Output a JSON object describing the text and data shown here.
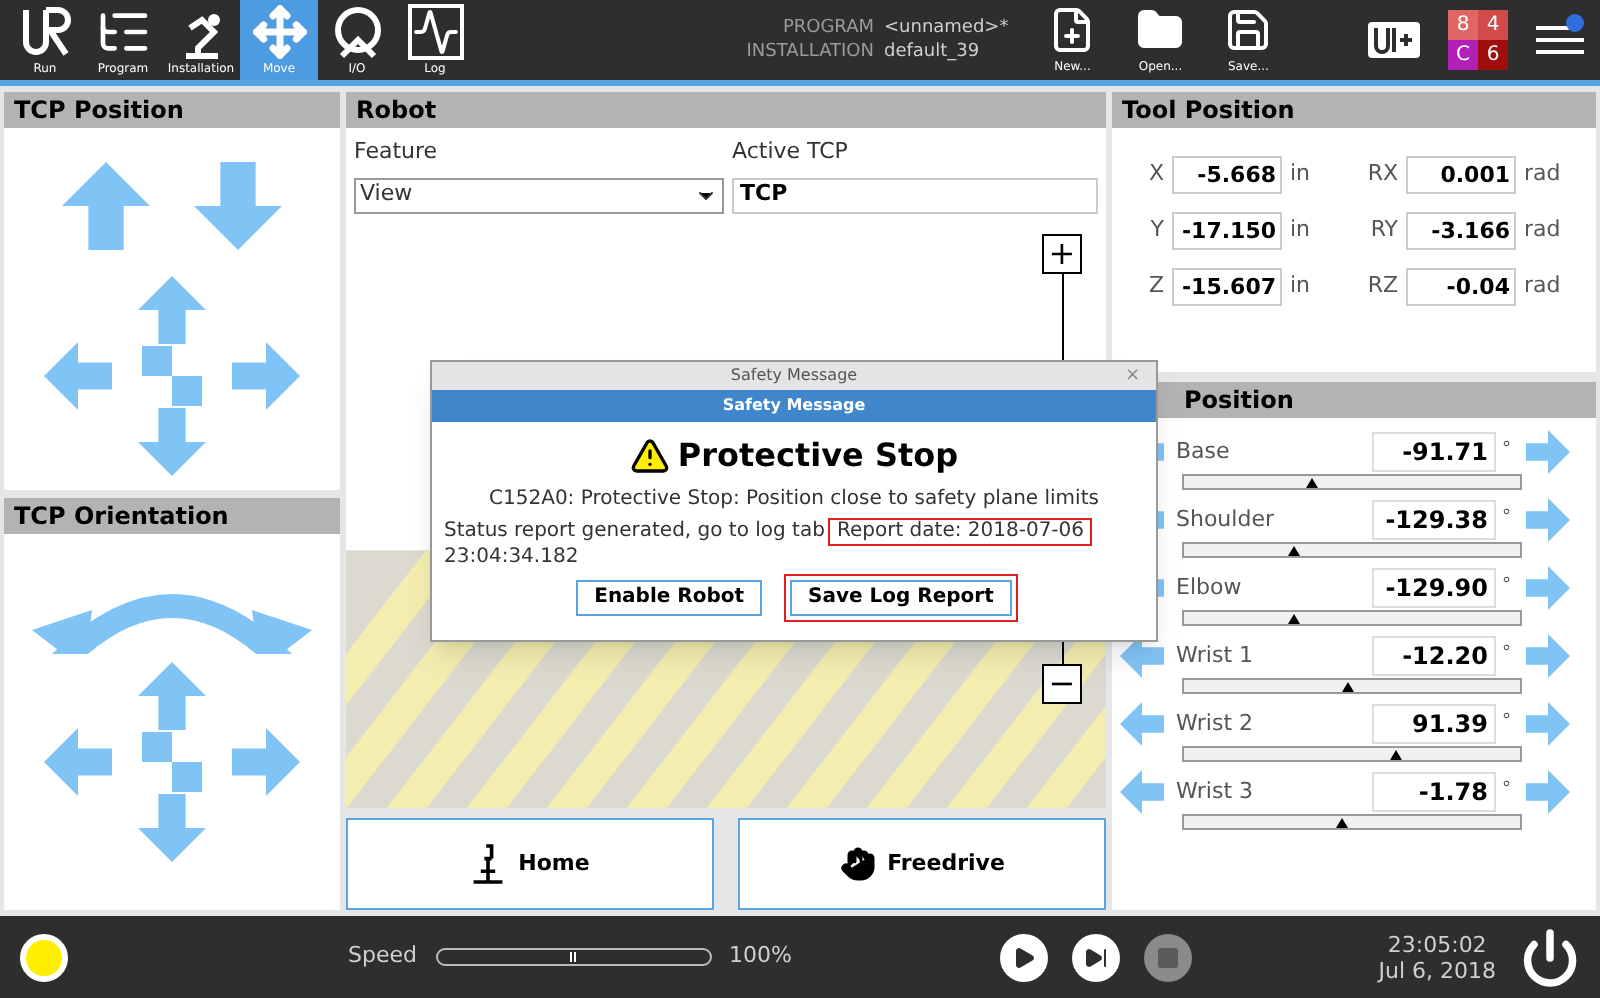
{
  "top_bar": {
    "tabs": [
      {
        "label": "Run",
        "kind": "run",
        "selected": false
      },
      {
        "label": "Program",
        "kind": "program",
        "selected": false
      },
      {
        "label": "Installation",
        "kind": "installation",
        "selected": false
      },
      {
        "label": "Move",
        "kind": "move",
        "selected": true
      },
      {
        "label": "I/O",
        "kind": "io",
        "selected": false
      },
      {
        "label": "Log",
        "kind": "log",
        "selected": false
      }
    ],
    "program": {
      "label": "PROGRAM",
      "value": "<unnamed>*"
    },
    "installation": {
      "label": "INSTALLATION",
      "value": "default_39"
    },
    "file_buttons": [
      {
        "label": "New...",
        "kind": "new"
      },
      {
        "label": "Open...",
        "kind": "open"
      },
      {
        "label": "Save...",
        "kind": "save"
      }
    ],
    "counters": [
      {
        "text": "8",
        "color": "#e06666"
      },
      {
        "text": "4",
        "color": "#d24a4a"
      },
      {
        "text": "C",
        "color": "#b320b8"
      },
      {
        "text": "6",
        "color": "#a00d0d"
      }
    ]
  },
  "tcp_position": {
    "title": "TCP Position"
  },
  "tcp_orientation": {
    "title": "TCP Orientation"
  },
  "robot": {
    "title": "Robot",
    "feature": {
      "label": "Feature",
      "value": "View"
    },
    "active_tcp": {
      "label": "Active TCP",
      "value": "TCP"
    },
    "zoom_in": "+",
    "zoom_out": "−",
    "buttons": [
      {
        "label": "Home",
        "kind": "home"
      },
      {
        "label": "Freedrive",
        "kind": "freedrive"
      }
    ]
  },
  "tool_position": {
    "title": "Tool Position",
    "fields": [
      {
        "axis": "X",
        "value": "-5.668",
        "unit": "in"
      },
      {
        "axis": "RX",
        "value": "0.001",
        "unit": "rad"
      },
      {
        "axis": "Y",
        "value": "-17.150",
        "unit": "in"
      },
      {
        "axis": "RY",
        "value": "-3.166",
        "unit": "rad"
      },
      {
        "axis": "Z",
        "value": "-15.607",
        "unit": "in"
      },
      {
        "axis": "RZ",
        "value": "-0.04",
        "unit": "rad"
      }
    ]
  },
  "joint_position": {
    "title": "Position",
    "joints": [
      {
        "name": "Base",
        "value": "-91.71",
        "unit": "°",
        "level": 0.38
      },
      {
        "name": "Shoulder",
        "value": "-129.38",
        "unit": "°",
        "level": 0.33
      },
      {
        "name": "Elbow",
        "value": "-129.90",
        "unit": "°",
        "level": 0.33
      },
      {
        "name": "Wrist 1",
        "value": "-12.20",
        "unit": "°",
        "level": 0.49
      },
      {
        "name": "Wrist 2",
        "value": "91.39",
        "unit": "°",
        "level": 0.63
      },
      {
        "name": "Wrist 3",
        "value": "-1.78",
        "unit": "°",
        "level": 0.47
      }
    ]
  },
  "dialog": {
    "title": "Safety Message",
    "close": "×",
    "header": "Safety Message",
    "heading": "Protective Stop",
    "message": "C152A0: Protective Stop: Position close to safety plane limits",
    "status": "Status report generated, go to log tab",
    "report_date": {
      "text": "Report date: 2018-07-06",
      "highlighted": true
    },
    "report_time": "23:04:34.182",
    "buttons": [
      {
        "label": "Enable Robot",
        "highlighted": false
      },
      {
        "label": "Save Log Report",
        "highlighted": true
      }
    ]
  },
  "bottom_bar": {
    "speed": {
      "label": "Speed",
      "level": 0.5,
      "reading": "100%"
    },
    "controls": [
      {
        "kind": "play",
        "disabled": false
      },
      {
        "kind": "step",
        "disabled": false
      },
      {
        "kind": "stop",
        "disabled": true
      }
    ],
    "time": "23:05:02",
    "date": "Jul 6, 2018"
  }
}
